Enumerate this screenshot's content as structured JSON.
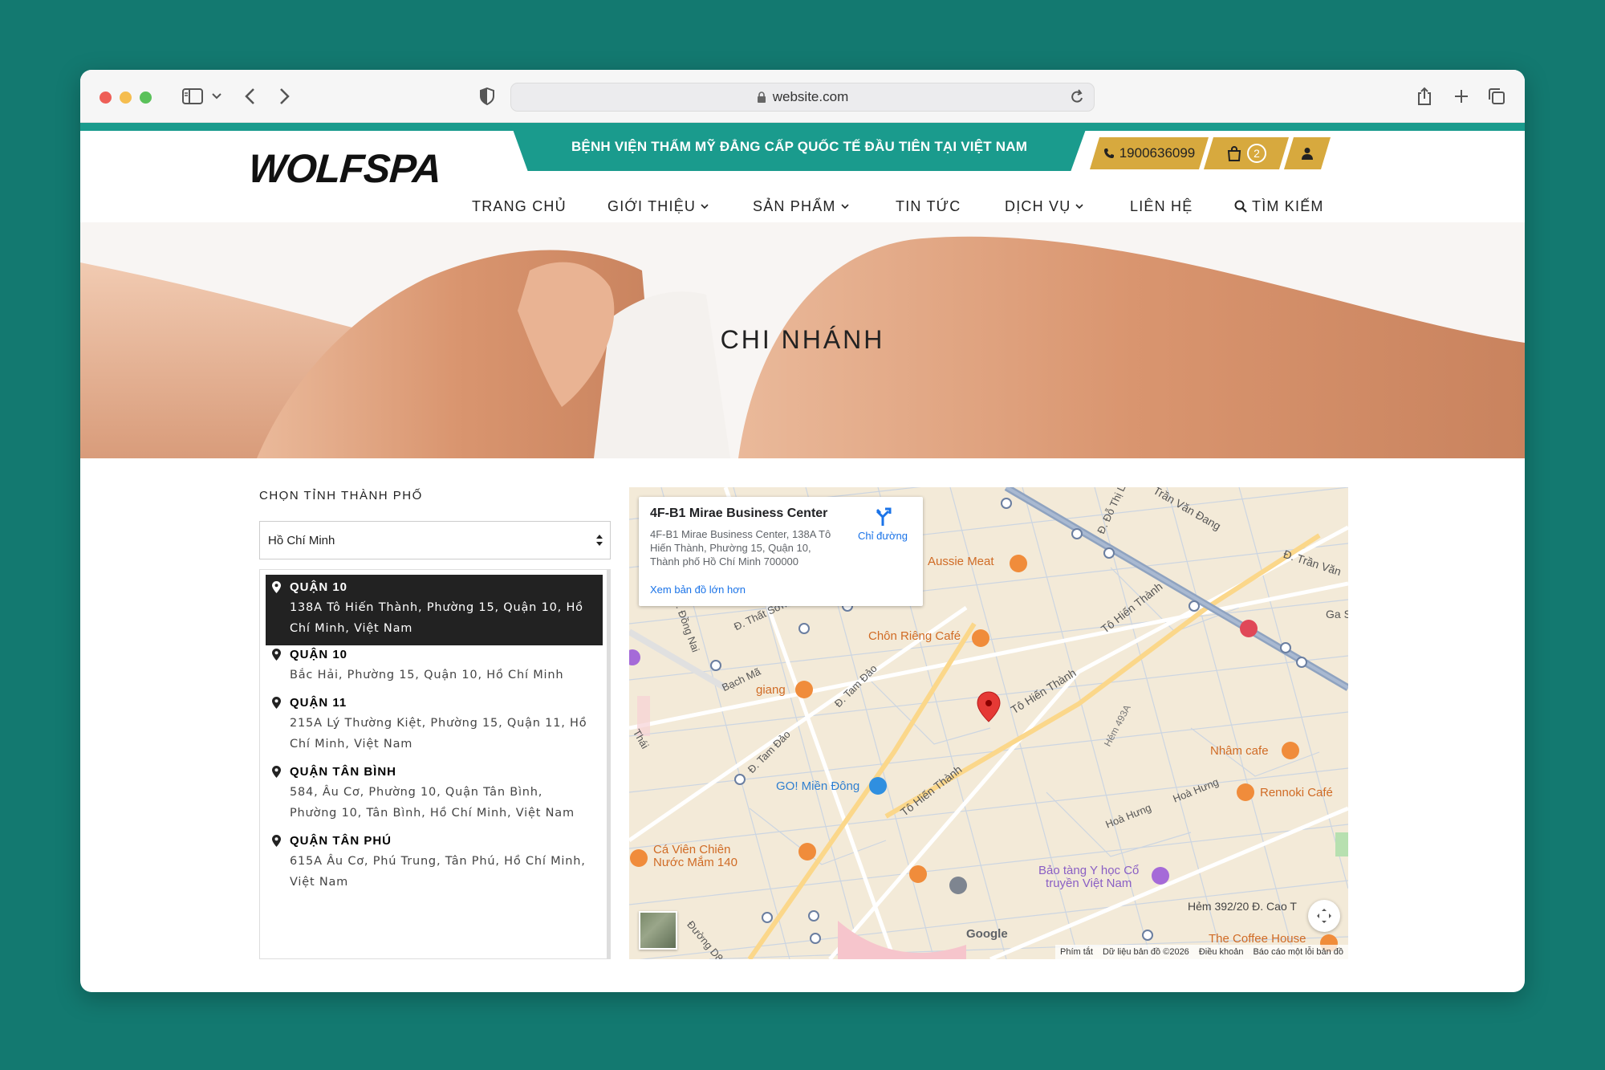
{
  "browser": {
    "url": "website.com"
  },
  "site": {
    "logo": "WOLFSPA",
    "banner": "BỆNH VIỆN THẨM MỸ ĐẲNG CẤP QUỐC TẾ ĐẦU TIÊN TẠI VIỆT NAM",
    "phone": "1900636099",
    "cart_count": "2",
    "accent": "#1a9b8d",
    "gold": "#d7a93e"
  },
  "nav": {
    "items": [
      {
        "label": "TRANG CHỦ"
      },
      {
        "label": "GIỚI THIỆU"
      },
      {
        "label": "SẢN PHẨM"
      },
      {
        "label": "TIN TỨC"
      },
      {
        "label": "DỊCH VỤ"
      },
      {
        "label": "LIÊN HỆ"
      },
      {
        "label": "TÌM KIẾM"
      }
    ]
  },
  "hero": {
    "title": "CHI NHÁNH"
  },
  "branches": {
    "label": "CHỌN TỈNH THÀNH PHỐ",
    "selected_city": "Hồ Chí Minh",
    "items": [
      {
        "name": "QUẬN 10",
        "address": "138A Tô Hiến Thành, Phường 15, Quận 10, Hồ Chí Minh, Việt Nam"
      },
      {
        "name": "QUẬN 10",
        "address": "Bắc Hải, Phường 15, Quận 10, Hồ Chí Minh"
      },
      {
        "name": "QUẬN 11",
        "address": "215A Lý Thường Kiệt, Phường 15, Quận 11, Hồ Chí Minh, Việt Nam"
      },
      {
        "name": "QUẬN TÂN BÌNH",
        "address": "584, Âu Cơ, Phường 10, Quận Tân Bình, Phường 10, Tân Bình, Hồ Chí Minh, Việt Nam"
      },
      {
        "name": "QUẬN TÂN PHÚ",
        "address": "615A Âu Cơ, Phú Trung, Tân Phú, Hồ Chí Minh, Việt Nam"
      }
    ]
  },
  "map": {
    "info_title": "4F-B1 Mirae Business Center",
    "info_address": "4F-B1 Mirae Business Center, 138A Tô Hiến Thành, Phường 15, Quận 10, Thành phố Hồ Chí Minh 700000",
    "directions": "Chỉ đường",
    "larger_map": "Xem bản đồ lớn hơn",
    "labels": {
      "aussie": "Aussie Meat",
      "chon_rieng": "Chôn Riêng Café",
      "giang": "giang",
      "go": "GO! Miền Đông",
      "nham": "Nhâm cafe",
      "rennoki": "Rennoki Café",
      "ca_vien_1": "Cá Viên Chiên",
      "ca_vien_2": "Nước Mắm 140",
      "bao_tang_1": "Bảo tàng Y học Cổ",
      "bao_tang_2": "truyền Việt Nam",
      "coffee_house": "The Coffee House",
      "hem": "Hẻm 392/20 Đ. Cao T",
      "to_hien_thanh": "Tô Hiến Thành",
      "tam_dao": "Đ. Tam Đảo",
      "tran_van_dang": "Trần Văn Đang",
      "do_thi": "Đ. Đỗ Thị L",
      "dong_nai": "Đ. Đồng Nai",
      "that_son": "Đ. Thất Sơn",
      "bach_ma": "Bạch Mã",
      "hoa_hung": "Hoà Hưng",
      "hem_493": "Hẻm 493A",
      "thai": "Thái",
      "duong_d8": "Đường D8",
      "tran_van_r": "Đ. Trần Văn",
      "ga": "Ga S",
      "google": "Google"
    },
    "footer": {
      "shortcuts": "Phím tắt",
      "data": "Dữ liệu bản đồ ©2026",
      "terms": "Điều khoản",
      "report": "Báo cáo một lỗi bản đồ"
    }
  }
}
